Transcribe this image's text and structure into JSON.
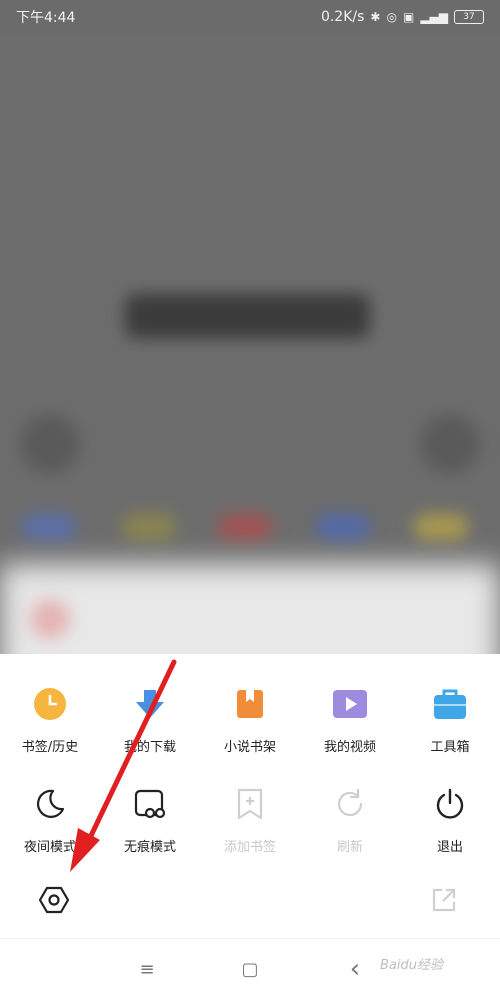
{
  "status_bar": {
    "time": "下午4:44",
    "net_speed": "0.2K/s",
    "battery": "37"
  },
  "menu": {
    "row1": [
      {
        "label": "书签/历史",
        "icon": "clock-icon",
        "color": "#F5B53F"
      },
      {
        "label": "我的下载",
        "icon": "download-arrow-icon",
        "color": "#4A90E2"
      },
      {
        "label": "小说书架",
        "icon": "bookshelf-icon",
        "color": "#F08C3A"
      },
      {
        "label": "我的视频",
        "icon": "video-play-icon",
        "color": "#9B8CE0"
      },
      {
        "label": "工具箱",
        "icon": "toolbox-icon",
        "color": "#3FA7E8"
      }
    ],
    "row2": [
      {
        "label": "夜间模式",
        "icon": "moon-icon",
        "disabled": false
      },
      {
        "label": "无痕模式",
        "icon": "incognito-icon",
        "disabled": false
      },
      {
        "label": "添加书签",
        "icon": "add-bookmark-icon",
        "disabled": true
      },
      {
        "label": "刷新",
        "icon": "refresh-icon",
        "disabled": true
      },
      {
        "label": "退出",
        "icon": "power-icon",
        "disabled": false
      }
    ],
    "bottom": {
      "settings_icon": "hexagon-settings-icon",
      "share_icon": "share-out-icon"
    }
  },
  "navbar": {
    "menu_icon": "≡",
    "home_icon": "▢",
    "back_icon": "‹"
  },
  "watermark": "Baidu经验",
  "colors": {
    "arrow": "#E02020",
    "sheet_bg": "#FFFFFF",
    "overlay": "#6B6B6B"
  }
}
